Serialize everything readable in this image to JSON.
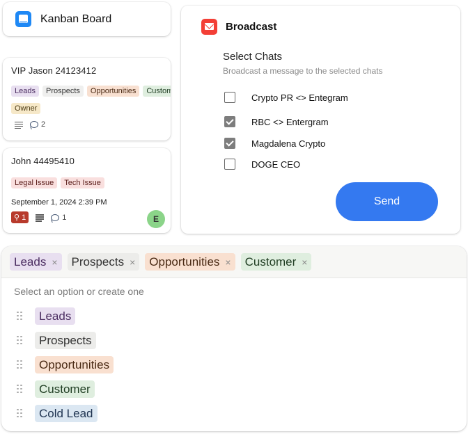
{
  "kanban": {
    "title": "Kanban Board",
    "icon": "board-icon",
    "cards": [
      {
        "title": "VIP Jason 24123412",
        "tags": [
          {
            "label": "Leads",
            "color": "purple"
          },
          {
            "label": "Prospects",
            "color": "gray"
          },
          {
            "label": "Opportunities",
            "color": "orange"
          },
          {
            "label": "Customer",
            "color": "green"
          }
        ],
        "extra_tag": {
          "label": "Owner",
          "color": "yellow"
        },
        "comments": "2"
      },
      {
        "title": "John 44495410",
        "tags": [
          {
            "label": "Legal Issue",
            "color": "red"
          },
          {
            "label": "Tech Issue",
            "color": "red"
          }
        ],
        "date": "September 1, 2024 2:39 PM",
        "pins": "1",
        "comments": "1",
        "assignee_initial": "E"
      }
    ]
  },
  "broadcast": {
    "title": "Broadcast",
    "section_label": "Select Chats",
    "section_sub": "Broadcast a message to the selected chats",
    "chats": [
      {
        "label": "Crypto PR <> Entegram",
        "checked": false
      },
      {
        "label": "RBC <> Entergram",
        "checked": true
      },
      {
        "label": "Magdalena Crypto",
        "checked": true
      },
      {
        "label": "DOGE CEO",
        "checked": false
      }
    ],
    "send_label": "Send",
    "accent": "#3479f0"
  },
  "multiselect": {
    "selected": [
      {
        "label": "Leads",
        "color": "purple"
      },
      {
        "label": "Prospects",
        "color": "gray"
      },
      {
        "label": "Opportunities",
        "color": "orange"
      },
      {
        "label": "Customer",
        "color": "green"
      }
    ],
    "remove_glyph": "×",
    "placeholder": "Select an option or create one",
    "options": [
      {
        "label": "Leads",
        "color": "purple"
      },
      {
        "label": "Prospects",
        "color": "gray"
      },
      {
        "label": "Opportunities",
        "color": "orange"
      },
      {
        "label": "Customer",
        "color": "green"
      },
      {
        "label": "Cold Lead",
        "color": "blue"
      }
    ]
  }
}
